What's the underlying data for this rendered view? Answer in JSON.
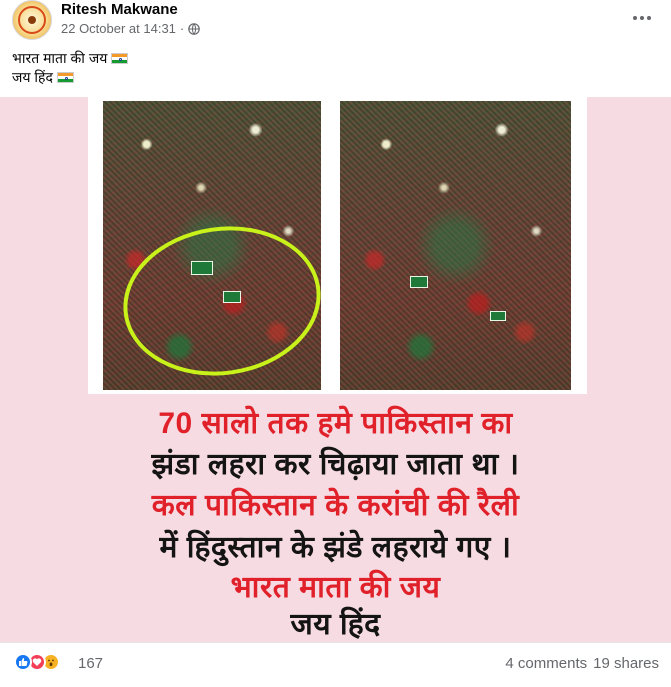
{
  "post": {
    "author": "Ritesh Makwane",
    "timestamp": "22 October at 14:31",
    "separator": "·",
    "privacy_icon": "globe-icon",
    "caption_lines": [
      "भारत माता की जय",
      "जय हिंद"
    ]
  },
  "image": {
    "text_lines": [
      {
        "text": "70 सालो तक हमे पाकिस्तान का",
        "color": "#e0212a"
      },
      {
        "text": "झंडा लहरा कर चिढ़ाया जाता था ।",
        "color": "#141414"
      },
      {
        "text": "कल पाकिस्तान के करांची की रैली",
        "color": "#e0212a"
      },
      {
        "text": "में हिंदुस्तान के झंडे लहराये गए ।",
        "color": "#141414"
      },
      {
        "text": "भारत माता की जय",
        "color": "#e0212a"
      },
      {
        "text": "जय हिंद",
        "color": "#141414"
      }
    ],
    "background_color": "#f6dbe3"
  },
  "footer": {
    "reaction_icons": [
      "like-icon",
      "love-icon",
      "wow-icon"
    ],
    "reaction_count": "167",
    "comments": "4 comments",
    "shares": "19 shares"
  },
  "colors": {
    "accent": "#1877f2",
    "highlight_ring": "#c9f21a"
  }
}
